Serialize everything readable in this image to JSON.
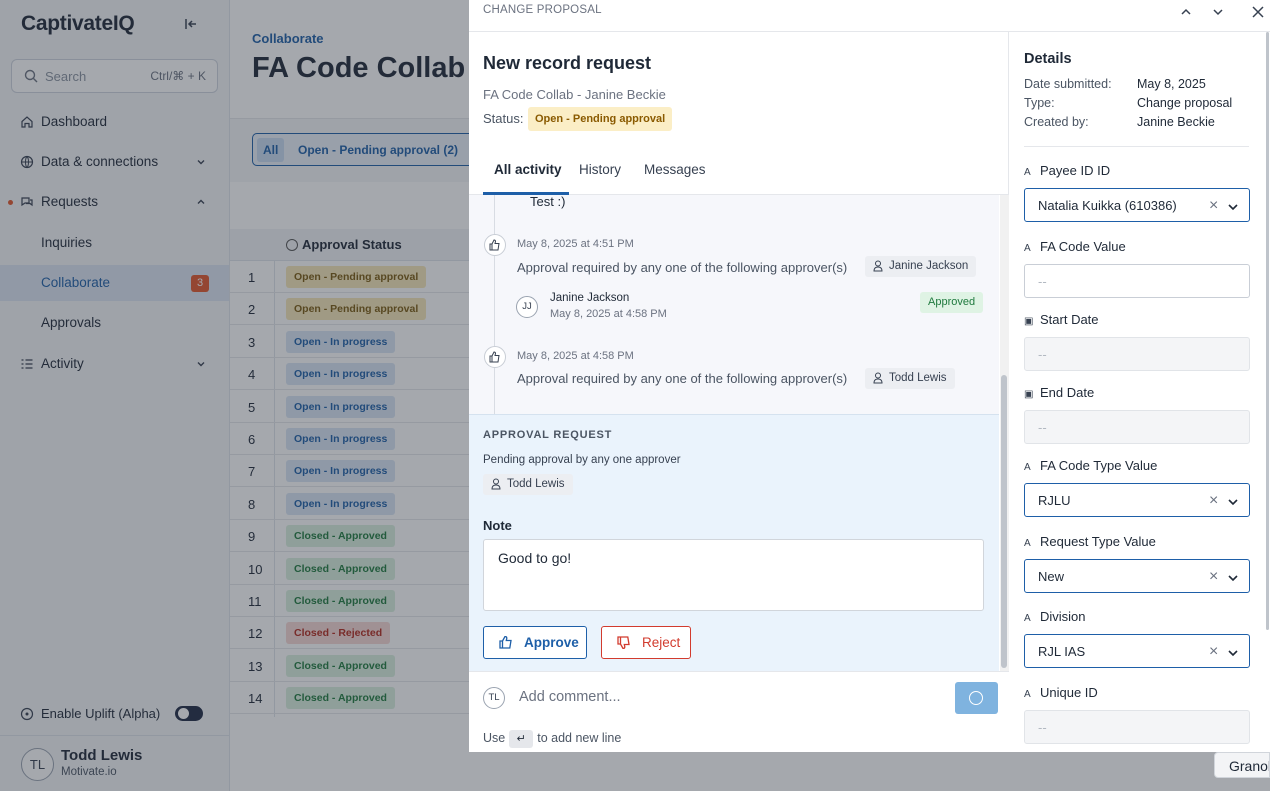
{
  "sidebar": {
    "logo": "CaptivateIQ",
    "search_placeholder": "Search",
    "search_shortcut": "Ctrl/⌘ + K",
    "items": [
      {
        "label": "Dashboard"
      },
      {
        "label": "Data & connections"
      },
      {
        "label": "Requests"
      },
      {
        "label": "Inquiries"
      },
      {
        "label": "Collaborate",
        "badge": "3"
      },
      {
        "label": "Approvals"
      },
      {
        "label": "Activity"
      }
    ],
    "uplift_label": "Enable Uplift (Alpha)",
    "user": {
      "initials": "TL",
      "name": "Todd Lewis",
      "org": "Motivate.io"
    }
  },
  "main": {
    "breadcrumb": "Collaborate",
    "title": "FA Code Collab",
    "filter_all": "All",
    "filter_open": "Open - Pending approval (2)",
    "column_header": "Approval Status",
    "rows": [
      {
        "num": "1",
        "status": "Open - Pending approval",
        "kind": "pending"
      },
      {
        "num": "2",
        "status": "Open - Pending approval",
        "kind": "pending"
      },
      {
        "num": "3",
        "status": "Open - In progress",
        "kind": "progress"
      },
      {
        "num": "4",
        "status": "Open - In progress",
        "kind": "progress"
      },
      {
        "num": "5",
        "status": "Open - In progress",
        "kind": "progress"
      },
      {
        "num": "6",
        "status": "Open - In progress",
        "kind": "progress"
      },
      {
        "num": "7",
        "status": "Open - In progress",
        "kind": "progress"
      },
      {
        "num": "8",
        "status": "Open - In progress",
        "kind": "progress"
      },
      {
        "num": "9",
        "status": "Closed - Approved",
        "kind": "approved"
      },
      {
        "num": "10",
        "status": "Closed - Approved",
        "kind": "approved"
      },
      {
        "num": "11",
        "status": "Closed - Approved",
        "kind": "approved"
      },
      {
        "num": "12",
        "status": "Closed - Rejected",
        "kind": "rejected"
      },
      {
        "num": "13",
        "status": "Closed - Approved",
        "kind": "approved"
      },
      {
        "num": "14",
        "status": "Closed - Approved",
        "kind": "approved"
      }
    ]
  },
  "panel": {
    "header": "CHANGE PROPOSAL",
    "title": "New record request",
    "subtitle": "FA Code Collab - Janine Beckie",
    "status_label": "Status:",
    "status_value": "Open - Pending approval",
    "tabs": [
      {
        "label": "All activity"
      },
      {
        "label": "History"
      },
      {
        "label": "Messages"
      }
    ],
    "feed": {
      "prev_message": "Test :)",
      "events": [
        {
          "date": "May 8, 2025 at 4:51 PM",
          "text": "Approval required by any one of the following approver(s)",
          "approver": "Janine Jackson"
        },
        {
          "date": "May 8, 2025 at 4:58 PM",
          "text": "Approval required by any one of the following approver(s)",
          "approver": "Todd Lewis"
        }
      ],
      "reply": {
        "initials": "JJ",
        "name": "Janine Jackson",
        "date": "May 8, 2025 at 4:58 PM",
        "badge": "Approved"
      }
    },
    "approval": {
      "title": "APPROVAL REQUEST",
      "subtitle": "Pending approval by any one approver",
      "approver": "Todd Lewis",
      "note_label": "Note",
      "note_value": "Good to go!",
      "approve_label": "Approve",
      "reject_label": "Reject"
    },
    "comment": {
      "initials": "TL",
      "placeholder": "Add comment...",
      "hint_prefix": "Use",
      "hint_key": "↵",
      "hint_suffix": "to add new line"
    }
  },
  "details": {
    "title": "Details",
    "rows": [
      {
        "label": "Date submitted:",
        "value": "May 8, 2025"
      },
      {
        "label": "Type:",
        "value": "Change proposal"
      },
      {
        "label": "Created by:",
        "value": "Janine Beckie"
      }
    ],
    "fields": [
      {
        "label": "Payee ID ID",
        "value": "Natalia Kuikka (610386)",
        "icon": "text-icon"
      },
      {
        "label": "FA Code Value",
        "value": "--",
        "icon": "text-icon"
      },
      {
        "label": "Start Date",
        "value": "--",
        "icon": "calendar-icon"
      },
      {
        "label": "End Date",
        "value": "--",
        "icon": "calendar-icon"
      },
      {
        "label": "FA Code Type Value",
        "value": "RJLU",
        "icon": "text-icon"
      },
      {
        "label": "Request Type Value",
        "value": "New",
        "icon": "text-icon"
      },
      {
        "label": "Division",
        "value": "RJL IAS",
        "icon": "text-icon"
      },
      {
        "label": "Unique ID",
        "value": "--",
        "icon": "text-icon"
      }
    ]
  },
  "granola": "Granola",
  "colors": {
    "accent": "#1e5fa8",
    "badge": "#e2572c",
    "pending": "#fbeec6",
    "approved": "#dff3e4",
    "rejected": "#fbe1df"
  }
}
